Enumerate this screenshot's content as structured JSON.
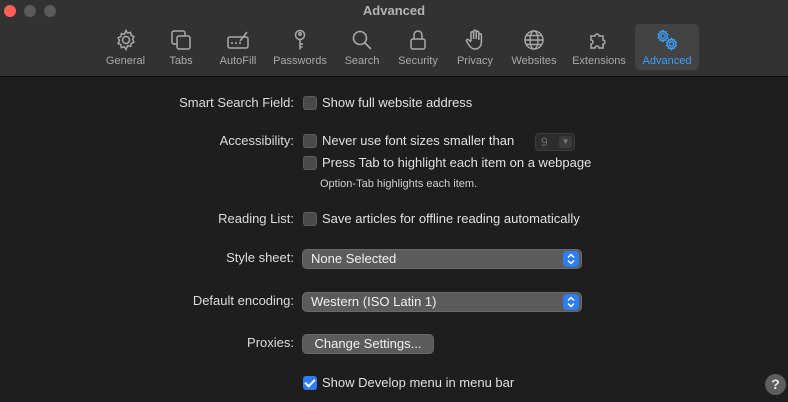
{
  "window": {
    "title": "Advanced"
  },
  "toolbar": {
    "items": [
      {
        "label": "General",
        "icon": "gear-icon"
      },
      {
        "label": "Tabs",
        "icon": "tabs-icon"
      },
      {
        "label": "AutoFill",
        "icon": "autofill-icon"
      },
      {
        "label": "Passwords",
        "icon": "key-icon"
      },
      {
        "label": "Search",
        "icon": "search-icon"
      },
      {
        "label": "Security",
        "icon": "lock-icon"
      },
      {
        "label": "Privacy",
        "icon": "hand-icon"
      },
      {
        "label": "Websites",
        "icon": "globe-icon"
      },
      {
        "label": "Extensions",
        "icon": "puzzle-icon"
      },
      {
        "label": "Advanced",
        "icon": "gears-icon"
      }
    ],
    "active": "Advanced",
    "active_color": "#3aa0ff"
  },
  "settings": {
    "smart_search": {
      "label": "Smart Search Field:",
      "option": "Show full website address",
      "checked": false
    },
    "accessibility": {
      "label": "Accessibility:",
      "font_option": "Never use font sizes smaller than",
      "font_size": "9",
      "tab_option": "Press Tab to highlight each item on a webpage",
      "hint": "Option-Tab highlights each item."
    },
    "reading_list": {
      "label": "Reading List:",
      "option": "Save articles for offline reading automatically"
    },
    "style_sheet": {
      "label": "Style sheet:",
      "value": "None Selected"
    },
    "encoding": {
      "label": "Default encoding:",
      "value": "Western (ISO Latin 1)"
    },
    "proxies": {
      "label": "Proxies:",
      "button": "Change Settings..."
    },
    "develop": {
      "option": "Show Develop menu in menu bar",
      "checked": true
    }
  },
  "help": {
    "symbol": "?"
  },
  "colors": {
    "accent": "#2f7df6",
    "background": "#1e1e1e"
  }
}
